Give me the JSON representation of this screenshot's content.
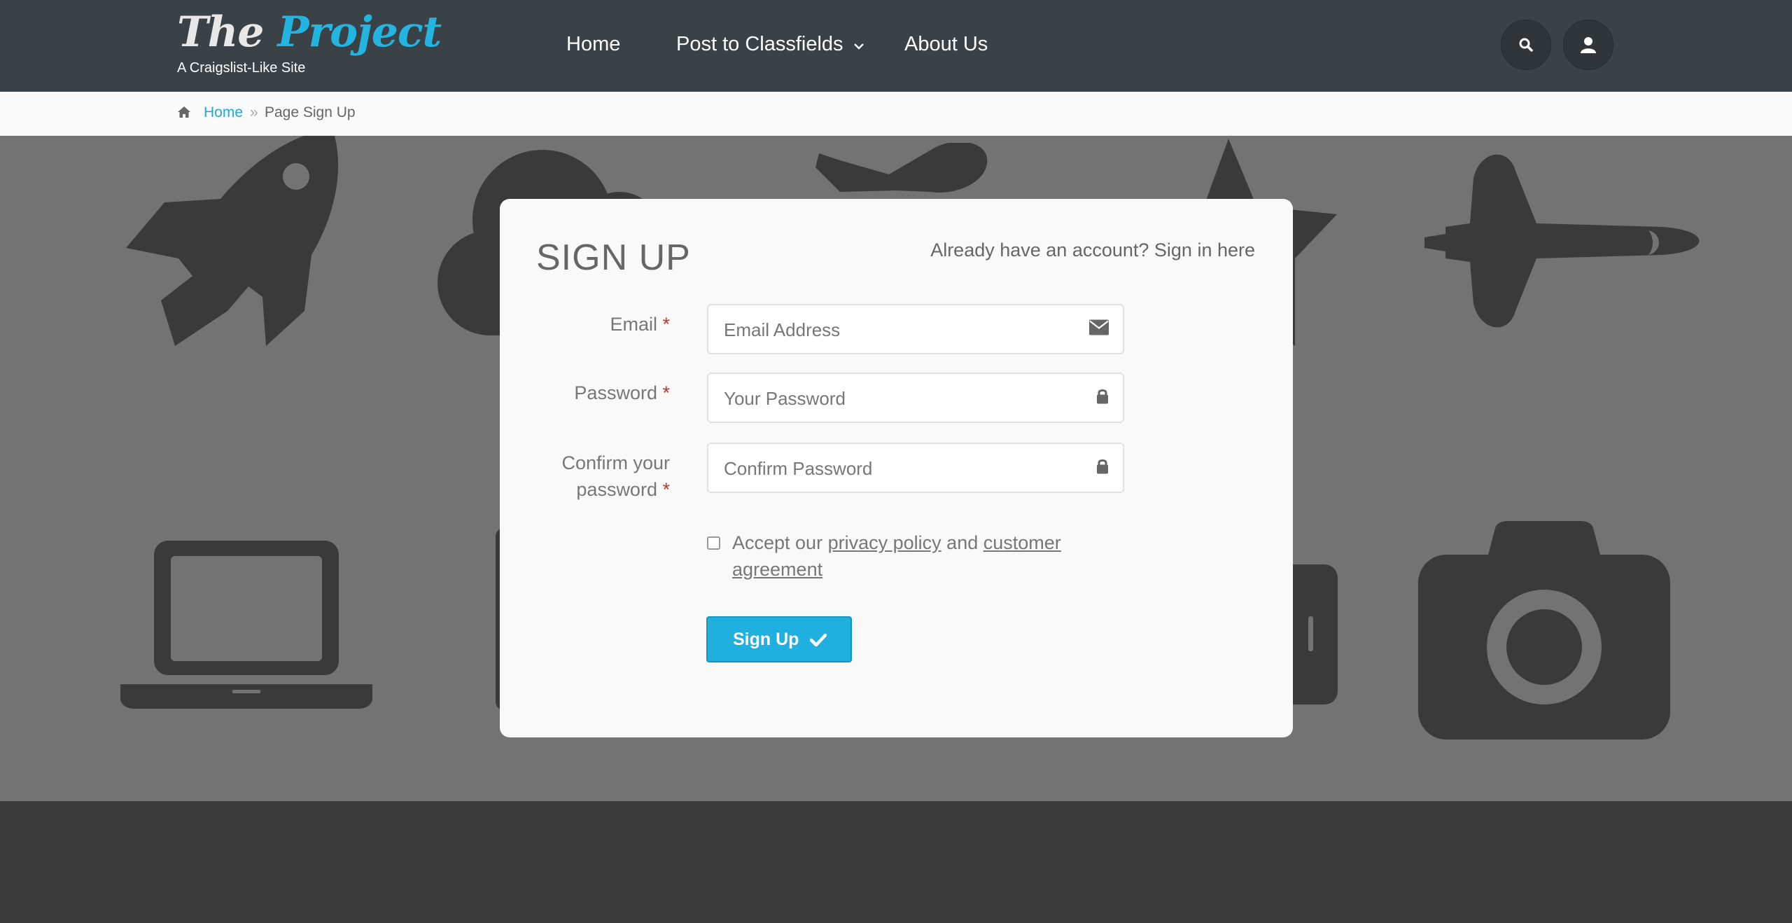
{
  "header": {
    "logo_the": "The",
    "logo_project": "Project",
    "tagline": "A Craigslist-Like Site",
    "nav": {
      "home": "Home",
      "post": "Post to Classfields",
      "about": "About Us"
    },
    "buttons": {
      "search_icon": "search-icon",
      "user_icon": "user-icon"
    }
  },
  "breadcrumb": {
    "home_label": "Home",
    "separator": "»",
    "current": "Page Sign Up"
  },
  "form": {
    "title": "SIGN UP",
    "signin_prompt": "Already have an account? Sign in here",
    "email": {
      "label": "Email",
      "required_mark": "*",
      "placeholder": "Email Address"
    },
    "password": {
      "label": "Password",
      "required_mark": "*",
      "placeholder": "Your Password"
    },
    "confirm": {
      "label_line1": "Confirm your",
      "label_line2": "password",
      "required_mark": "*",
      "placeholder": "Confirm Password"
    },
    "terms": {
      "prefix": "Accept our",
      "privacy_link": "privacy policy",
      "and": "and",
      "agreement_link": "customer agreement",
      "checked": false
    },
    "submit_label": "Sign Up"
  },
  "colors": {
    "header_bg": "#3b4247",
    "accent": "#23b4e0",
    "bg_area": "#737373",
    "icon": "#3a3a3a",
    "required": "#c0392b"
  }
}
